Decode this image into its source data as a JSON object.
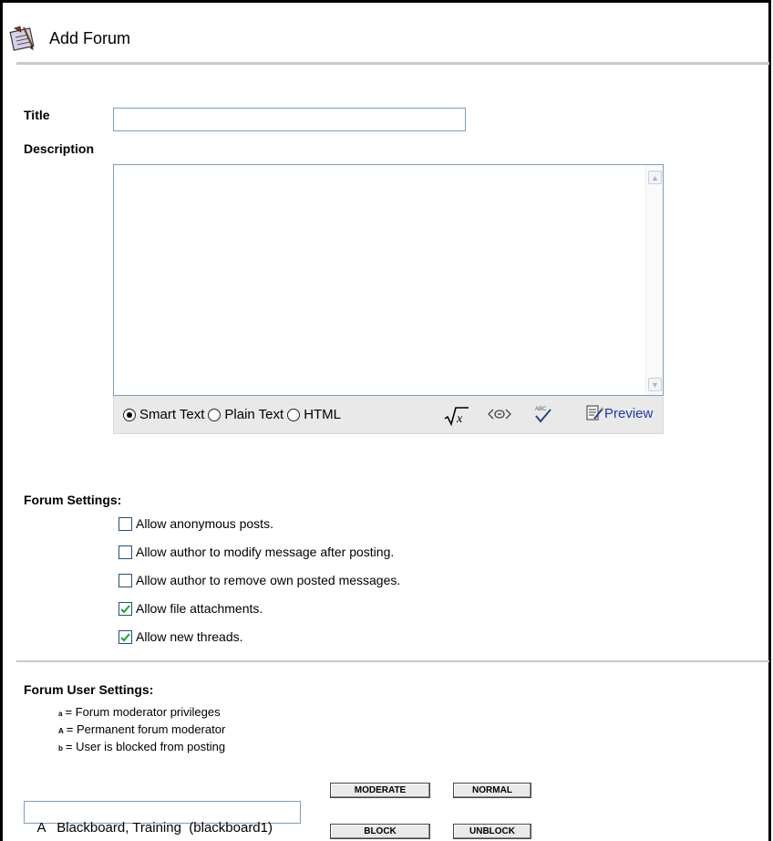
{
  "header": {
    "title": "Add Forum",
    "icon": "forum-edit-icon"
  },
  "form": {
    "title_label": "Title",
    "title_value": "",
    "description_label": "Description",
    "description_value": ""
  },
  "editor_toolbar": {
    "modes": [
      {
        "label": "Smart Text",
        "selected": true
      },
      {
        "label": "Plain Text",
        "selected": false
      },
      {
        "label": "HTML",
        "selected": false
      }
    ],
    "tools": [
      "math-equation-icon",
      "link-icon",
      "spell-check-icon"
    ],
    "preview_label": "Preview"
  },
  "forum_settings": {
    "title": "Forum Settings:",
    "options": [
      {
        "label": "Allow anonymous posts.",
        "checked": false
      },
      {
        "label": "Allow author to modify message after posting.",
        "checked": false
      },
      {
        "label": "Allow author to remove own posted messages.",
        "checked": false
      },
      {
        "label": "Allow file attachments.",
        "checked": true
      },
      {
        "label": "Allow new threads.",
        "checked": true
      }
    ]
  },
  "user_settings": {
    "title": "Forum User Settings:",
    "legend": [
      {
        "key": "a",
        "text": "= Forum moderator privileges"
      },
      {
        "key": "A",
        "text": "= Permanent forum moderator"
      },
      {
        "key": "b",
        "text": "= User is blocked from posting"
      }
    ],
    "users": [
      "A   Blackboard, Training  (blackboard1)"
    ],
    "buttons": {
      "moderate": "MODERATE",
      "normal": "NORMAL",
      "block": "BLOCK",
      "unblock": "UNBLOCK"
    }
  }
}
